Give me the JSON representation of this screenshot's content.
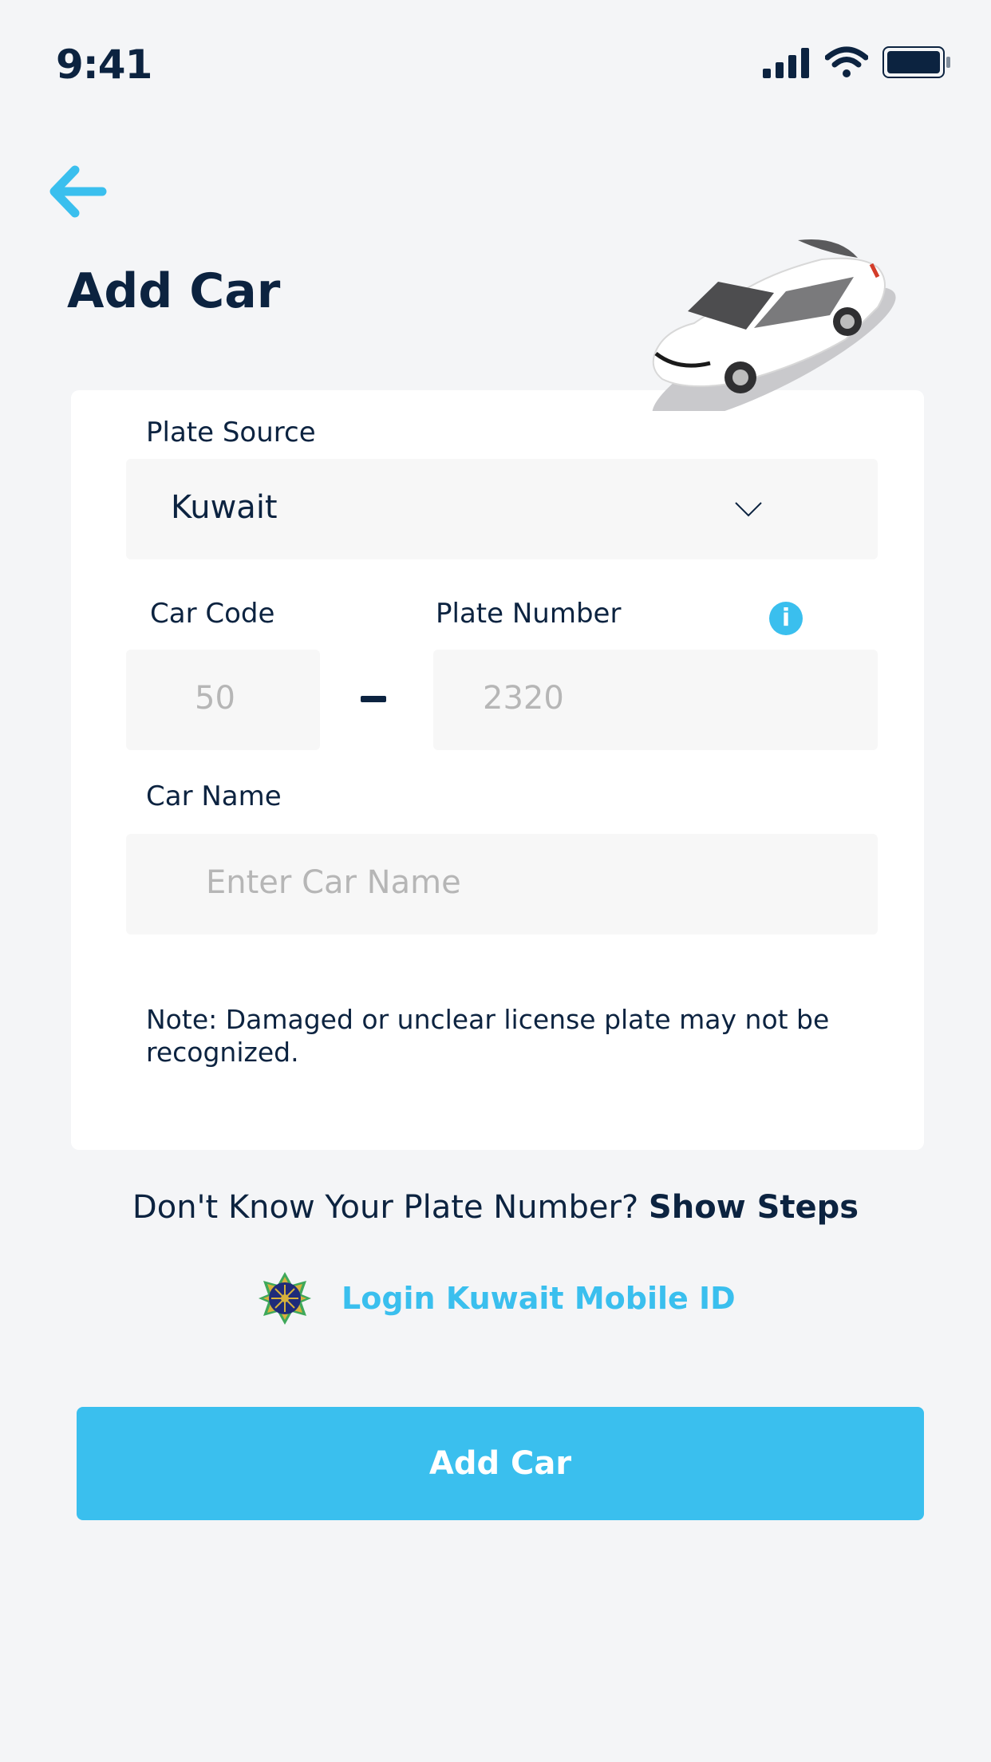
{
  "status_bar": {
    "time": "9:41"
  },
  "header": {
    "title": "Add Car"
  },
  "form": {
    "plate_source": {
      "label": "Plate Source",
      "value": "Kuwait"
    },
    "car_code": {
      "label": "Car Code",
      "value": "50"
    },
    "separator": "-",
    "plate_number": {
      "label": "Plate Number",
      "value": "2320"
    },
    "car_name": {
      "label": "Car Name",
      "placeholder": "Enter Car Name"
    },
    "note": "Note: Damaged or unclear license plate may not be recognized."
  },
  "help": {
    "question": "Don't Know Your  Plate Number?",
    "link": "Show Steps"
  },
  "mobile_id": {
    "label": "Login Kuwait Mobile ID"
  },
  "primary_button": {
    "label": "Add Car"
  },
  "colors": {
    "accent": "#3abfee",
    "navy": "#0c2340",
    "background": "#f4f5f7",
    "field": "#f7f7f7"
  },
  "icons": [
    "back-arrow-icon",
    "signal-icon",
    "wifi-icon",
    "battery-icon",
    "chevron-down-icon",
    "info-icon",
    "kuwait-mobile-id-logo-icon"
  ]
}
